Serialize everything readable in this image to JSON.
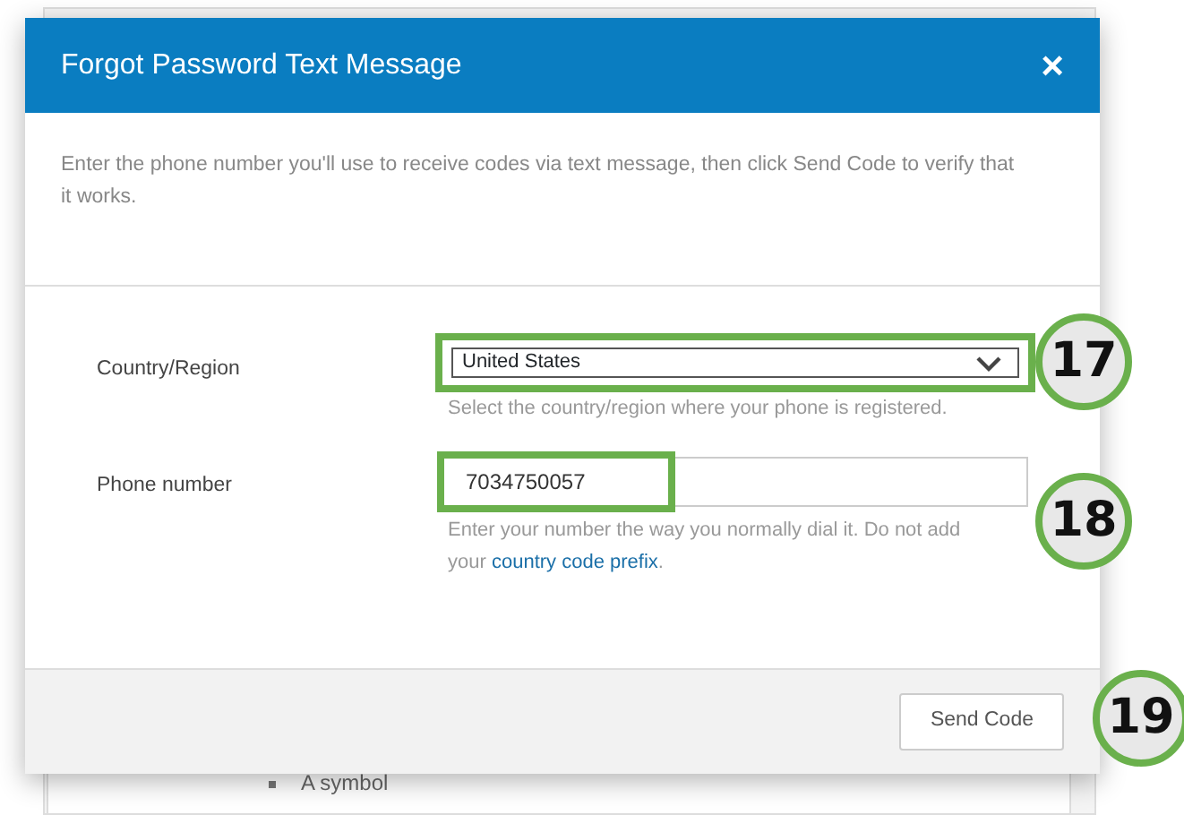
{
  "dialog": {
    "title": "Forgot Password Text Message",
    "close": "×",
    "description": "Enter the phone number you'll use to receive codes via text message, then click Send Code to verify that it works.",
    "fields": [
      {
        "kind": "select",
        "label": "Country/Region",
        "value": "United States",
        "help": "Select the country/region where your phone is registered.",
        "highlighted": true,
        "callout": "17"
      },
      {
        "kind": "text",
        "label": "Phone number",
        "value": "7034750057",
        "help_before": "Enter your number the way you normally dial it. Do not add your ",
        "help_link": "country code prefix",
        "help_after": ".",
        "highlighted": true,
        "callout": "18"
      }
    ],
    "button": {
      "label": "Send Code",
      "callout": "19"
    }
  },
  "background": {
    "bullets": [
      "A symbol"
    ]
  }
}
